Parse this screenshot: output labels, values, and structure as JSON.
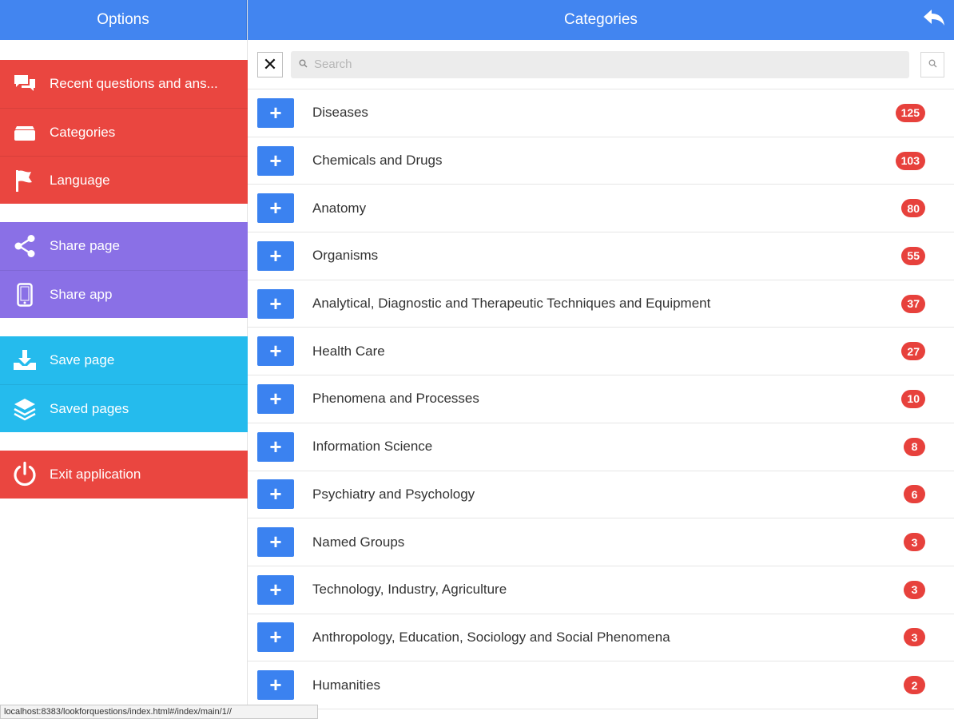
{
  "left_panel": {
    "title": "Options",
    "groups": [
      {
        "color": "#ea4640",
        "items": [
          {
            "label": "Recent questions and ans...",
            "icon": "chat-bubbles-icon"
          },
          {
            "label": "Categories",
            "icon": "tray-icon"
          },
          {
            "label": "Language",
            "icon": "flag-icon"
          }
        ]
      },
      {
        "color": "#8a70e6",
        "items": [
          {
            "label": "Share page",
            "icon": "share-icon"
          },
          {
            "label": "Share app",
            "icon": "phone-icon"
          }
        ]
      },
      {
        "color": "#25bbed",
        "items": [
          {
            "label": "Save page",
            "icon": "download-icon"
          },
          {
            "label": "Saved pages",
            "icon": "layers-icon"
          }
        ]
      },
      {
        "color": "#ea4640",
        "items": [
          {
            "label": "Exit application",
            "icon": "power-icon"
          }
        ]
      }
    ]
  },
  "right_panel": {
    "title": "Categories",
    "back_icon": "back-arrow-icon",
    "search": {
      "placeholder": "Search",
      "value": ""
    },
    "categories": [
      {
        "name": "Diseases",
        "count": "125"
      },
      {
        "name": "Chemicals and Drugs",
        "count": "103"
      },
      {
        "name": "Anatomy",
        "count": "80"
      },
      {
        "name": "Organisms",
        "count": "55"
      },
      {
        "name": "Analytical, Diagnostic and Therapeutic Techniques and Equipment",
        "count": "37"
      },
      {
        "name": "Health Care",
        "count": "27"
      },
      {
        "name": "Phenomena and Processes",
        "count": "10"
      },
      {
        "name": "Information Science",
        "count": "8"
      },
      {
        "name": "Psychiatry and Psychology",
        "count": "6"
      },
      {
        "name": "Named Groups",
        "count": "3"
      },
      {
        "name": "Technology, Industry, Agriculture",
        "count": "3"
      },
      {
        "name": "Anthropology, Education, Sociology and Social Phenomena",
        "count": "3"
      },
      {
        "name": "Humanities",
        "count": "2"
      }
    ]
  },
  "status_url": "localhost:8383/lookforquestions/index.html#/index/main/1//",
  "colors": {
    "header": "#4285f0",
    "add_button": "#3b82f0",
    "badge": "#e7413c"
  }
}
